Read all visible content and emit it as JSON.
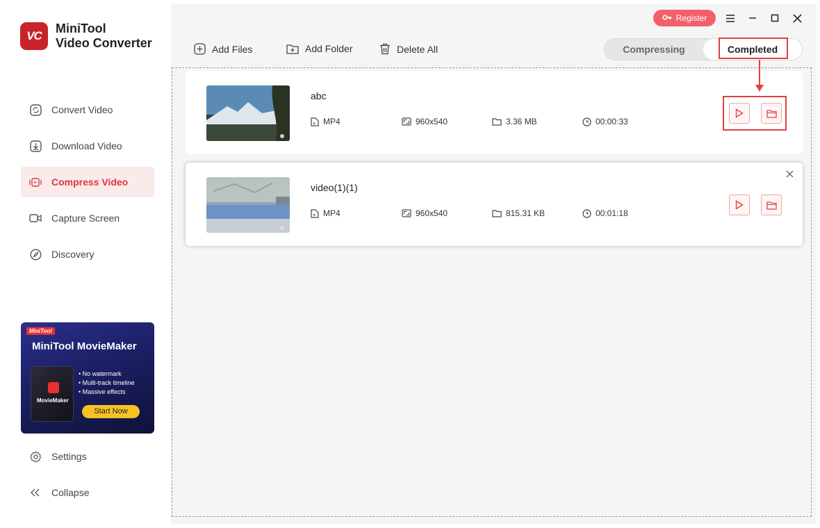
{
  "app": {
    "logo_text": "VC",
    "title_line1": "MiniTool",
    "title_line2": "Video Converter"
  },
  "sidebar": {
    "items": [
      {
        "label": "Convert Video",
        "icon": "convert-icon",
        "active": false
      },
      {
        "label": "Download Video",
        "icon": "download-icon",
        "active": false
      },
      {
        "label": "Compress Video",
        "icon": "compress-icon",
        "active": true
      },
      {
        "label": "Capture Screen",
        "icon": "camera-icon",
        "active": false
      },
      {
        "label": "Discovery",
        "icon": "compass-icon",
        "active": false
      }
    ],
    "settings_label": "Settings",
    "collapse_label": "Collapse"
  },
  "ad": {
    "brand": "MiniTool",
    "title": "MiniTool MovieMaker",
    "box_label": "MovieMaker",
    "features": [
      "• No watermark",
      "• Multi-track timeline",
      "• Massive effects"
    ],
    "cta": "Start Now"
  },
  "header": {
    "register_label": "Register"
  },
  "toolbar": {
    "add_files": "Add Files",
    "add_folder": "Add Folder",
    "delete_all": "Delete All"
  },
  "tabs": {
    "compressing": "Compressing",
    "completed": "Completed",
    "active": "completed"
  },
  "files": [
    {
      "name": "abc",
      "format": "MP4",
      "resolution": "960x540",
      "size": "3.36 MB",
      "duration": "00:00:33"
    },
    {
      "name": "video(1)(1)",
      "format": "MP4",
      "resolution": "960x540",
      "size": "815.31 KB",
      "duration": "00:01:18"
    }
  ],
  "colors": {
    "accent": "#d8383f",
    "highlight": "#e2403d",
    "register": "#f2616a"
  }
}
